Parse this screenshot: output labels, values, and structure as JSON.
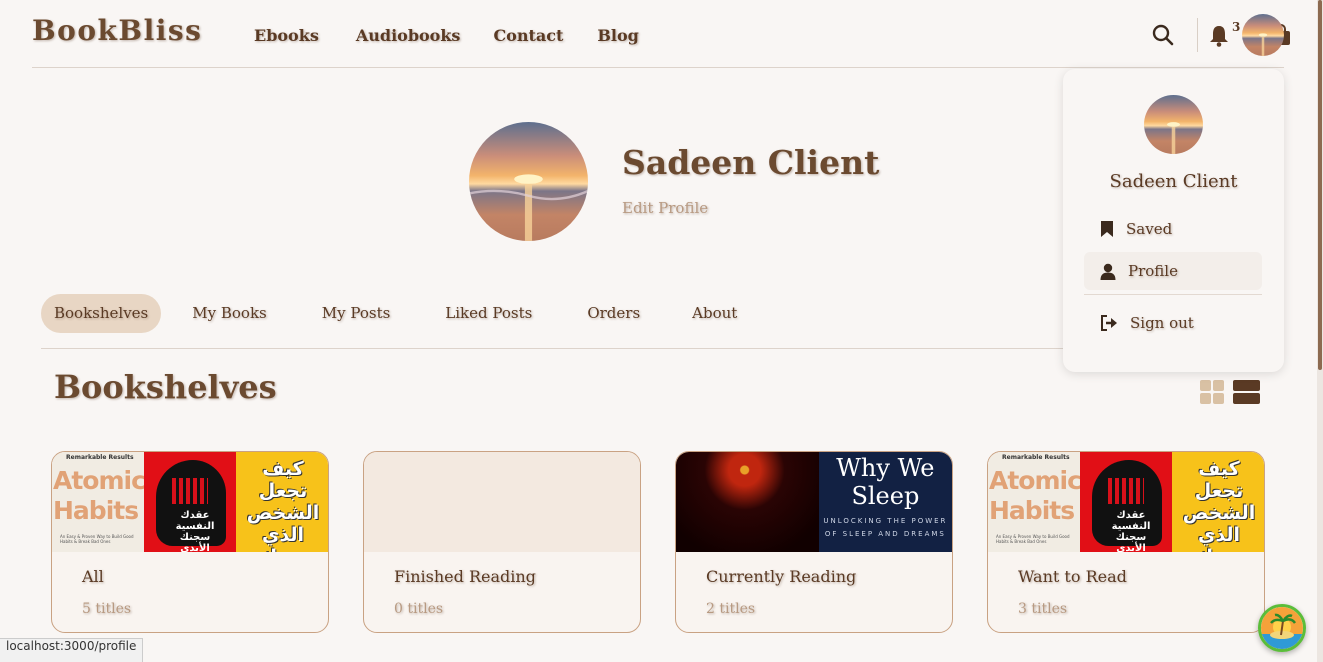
{
  "header": {
    "logo": "BookBliss",
    "nav": [
      "Ebooks",
      "Audiobooks",
      "Contact",
      "Blog"
    ],
    "notification_count": "3"
  },
  "profile": {
    "name": "Sadeen Client",
    "edit_label": "Edit Profile"
  },
  "tabs": [
    "Bookshelves",
    "My Books",
    "My Posts",
    "Liked Posts",
    "Orders",
    "About"
  ],
  "active_tab": "Bookshelves",
  "section": {
    "title": "Bookshelves"
  },
  "shelves": [
    {
      "name": "All",
      "count": "5 titles"
    },
    {
      "name": "Finished Reading",
      "count": "0 titles"
    },
    {
      "name": "Currently Reading",
      "count": "2 titles"
    },
    {
      "name": "Want to Read",
      "count": "3 titles"
    }
  ],
  "covers": {
    "atomic_top": "Remarkable Results",
    "atomic_title": "Atomic Habits",
    "atomic_sub": "An Easy & Proven Way to Build Good Habits & Break Bad Ones",
    "red_title": "عقدك النفسية سجنك الأبدي",
    "yellow_title": "كيف تجعل الشخص الذي يحبك",
    "sleep_title": "Why We Sleep",
    "sleep_sub": "UNLOCKING THE POWER OF SLEEP AND DREAMS"
  },
  "dropdown": {
    "name": "Sadeen Client",
    "items": [
      "Saved",
      "Profile",
      "Sign out"
    ]
  },
  "status_url": "localhost:3000/profile",
  "icons": [
    "search-icon",
    "bell-icon",
    "chat-icon",
    "shopping-bag-icon",
    "bookmark-icon",
    "user-icon",
    "sign-out-icon",
    "grid-view-icon",
    "list-view-icon"
  ],
  "colors": {
    "brand": "#6b4a30",
    "accent": "#e8d6c4",
    "muted": "#b89a82",
    "background": "#f9f6f4"
  }
}
